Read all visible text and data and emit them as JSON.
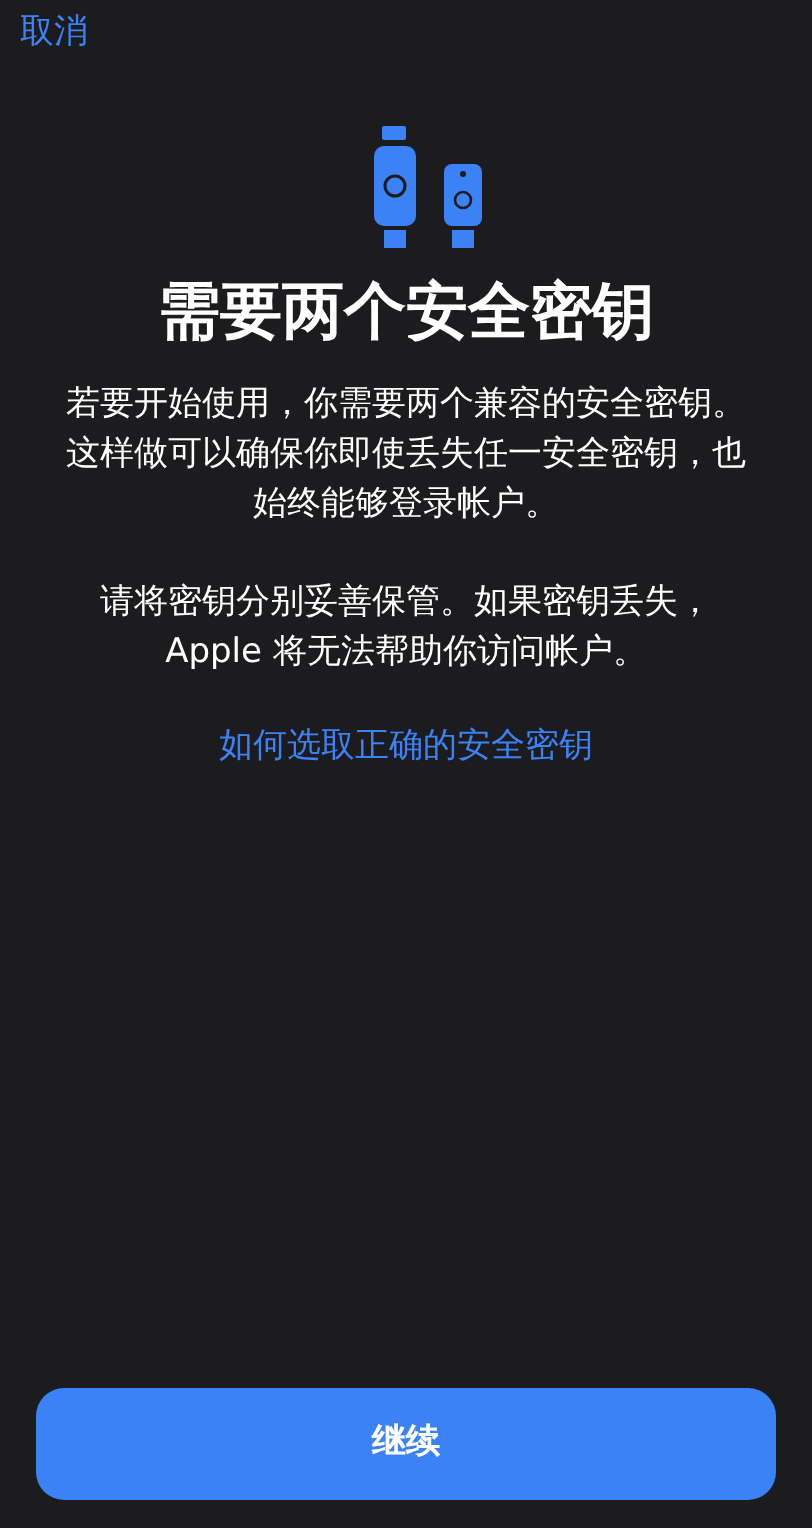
{
  "cancel": "取消",
  "title": "需要两个安全密钥",
  "paragraphs": [
    "若要开始使用，你需要两个兼容的安全密钥。这样做可以确保你即使丢失任一安全密钥，也始终能够登录帐户。",
    "请将密钥分别妥善保管。如果密钥丢失，Apple 将无法帮助你访问帐户。"
  ],
  "link": "如何选取正确的安全密钥",
  "continue_button": "继续"
}
